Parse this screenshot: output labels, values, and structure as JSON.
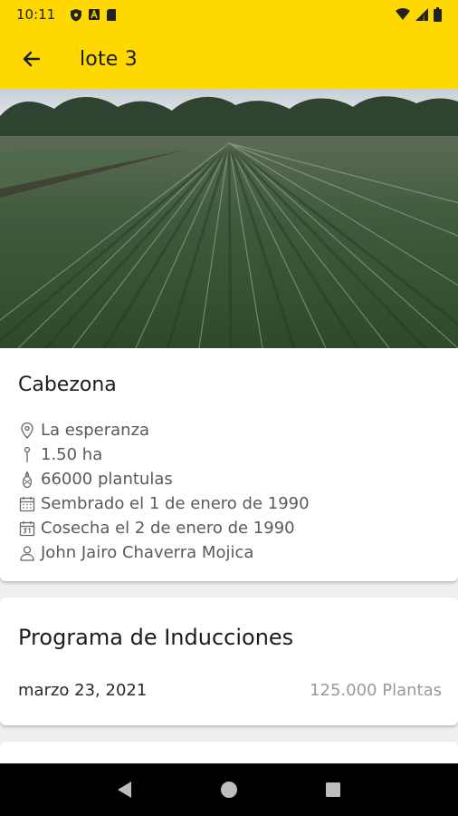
{
  "status_bar": {
    "time": "10:11",
    "icons_left": [
      "shield-icon",
      "a-box-icon",
      "sim-icon"
    ],
    "icons_right": [
      "wifi-icon",
      "signal-icon",
      "battery-icon"
    ]
  },
  "app_bar": {
    "title": "lote 3",
    "back_icon": "arrow-left-icon",
    "background": "#ffd800"
  },
  "hero": {
    "image": "pineapple-field-photo"
  },
  "lot_card": {
    "name": "Cabezona",
    "details": [
      {
        "icon": "location-pin-icon",
        "text": "La esperanza"
      },
      {
        "icon": "pin-icon",
        "text": "1.50 ha"
      },
      {
        "icon": "pineapple-icon",
        "text": "66000 plantulas"
      },
      {
        "icon": "calendar-icon",
        "text": "Sembrado el 1 de enero de 1990"
      },
      {
        "icon": "calendar-31-icon",
        "text": "Cosecha el 2 de enero de 1990"
      },
      {
        "icon": "person-icon",
        "text": "John Jairo Chaverra Mojica"
      }
    ]
  },
  "program_card": {
    "title": "Programa de Inducciones",
    "date": "marzo 23, 2021",
    "plants": "125.000 Plantas"
  },
  "nav_bar": {
    "buttons": [
      "back-triangle-icon",
      "home-circle-icon",
      "recents-square-icon"
    ]
  }
}
